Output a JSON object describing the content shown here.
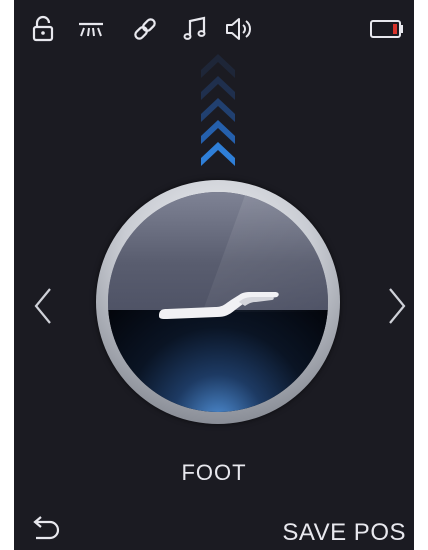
{
  "status_bar": {
    "icons": [
      "lock-icon",
      "light-icon",
      "link-icon",
      "music-icon",
      "speaker-icon"
    ],
    "battery_icon": "battery-low-icon"
  },
  "dial": {
    "icon": "bed-foot-raise-icon",
    "direction_indicator": "up-chevrons-icon",
    "direction_levels": 5,
    "active_levels": 2
  },
  "navigation": {
    "prev_icon": "chevron-left-icon",
    "next_icon": "chevron-right-icon"
  },
  "mode": {
    "label": "FOOT"
  },
  "footer": {
    "back_icon": "back-arrow-icon",
    "save_label": "SAVE POS"
  },
  "colors": {
    "background": "#1b1b22",
    "accent": "#2f7fd8",
    "battery_low": "#d9332b"
  }
}
